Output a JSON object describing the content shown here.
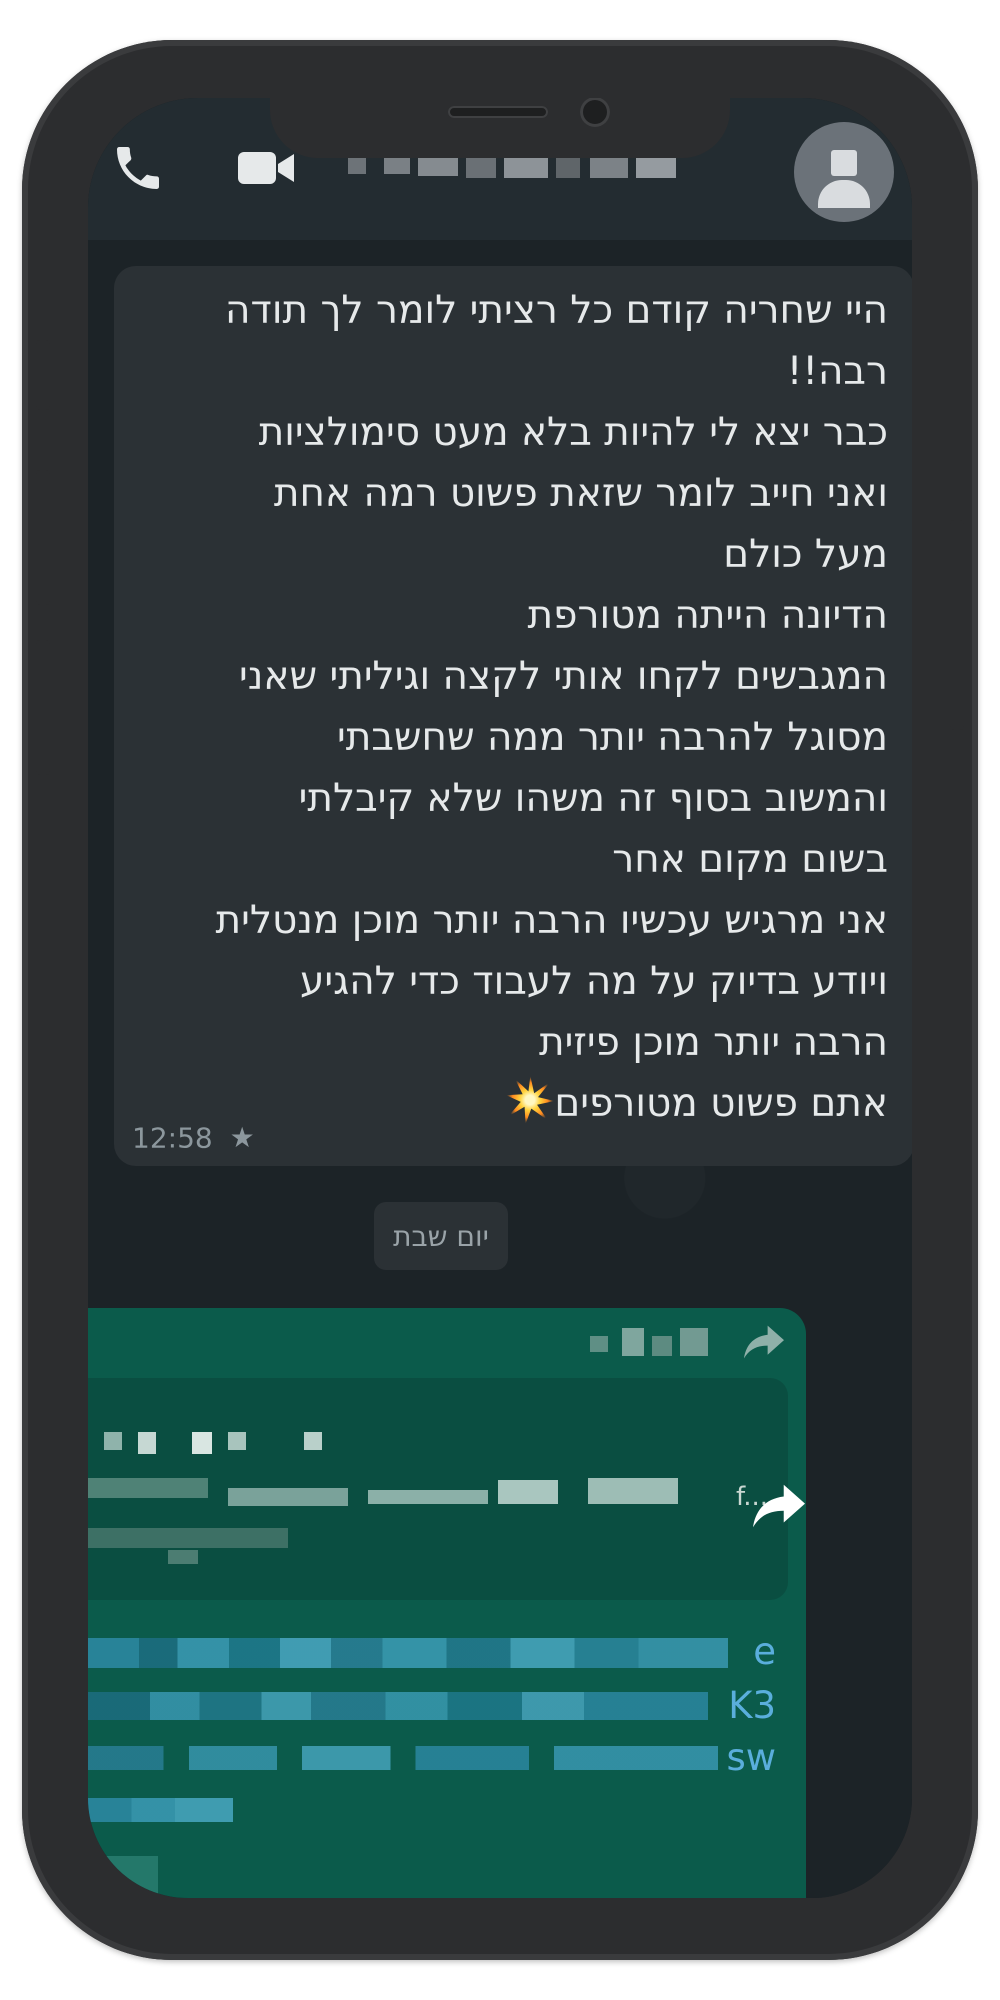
{
  "header": {
    "contact_name": "",
    "icons": {
      "call": "phone-icon",
      "video": "video-call-icon",
      "avatar": "default-avatar-icon"
    }
  },
  "incoming_message": {
    "lines": [
      "היי שחריה קודם כל רציתי לומר לך תודה",
      "רבה!!",
      "כבר יצא לי להיות בלא מעט סימולציות",
      "ואני חייב לומר שזאת פשוט רמה אחת",
      "מעל כולם",
      "הדיונה הייתה מטורפת",
      "המגבשים לקחו אותי לקצה וגיליתי שאני",
      "מסוגל להרבה יותר ממה שחשבתי",
      "והמשוב בסוף זה משהו שלא קיבלתי",
      "בשום מקום אחר",
      "אני מרגיש עכשיו הרבה יותר מוכן מנטלית",
      "ויודע בדיוק על מה לעבוד כדי להגיע",
      "הרבה יותר מוכן פיזית",
      "אתם פשוט מטורפים"
    ],
    "emoji": "collision-emoji",
    "time": "12:58",
    "starred": "★"
  },
  "date_divider": {
    "label": "יום שבת"
  },
  "forwarded_message": {
    "preview_suffix": "f...",
    "link_fragments": [
      "e",
      "K3",
      "sw"
    ],
    "icons": {
      "forwarded": "forwarded-arrow-icon",
      "forward_button": "share-forward-icon"
    }
  },
  "colors": {
    "chat_bg": "#1c2327",
    "header_bg": "#232c31",
    "incoming_bubble": "#2b3135",
    "outgoing_bubble": "#0b5b4b",
    "link": "#5aaedc",
    "phone_frame": "#2c2d2f"
  }
}
